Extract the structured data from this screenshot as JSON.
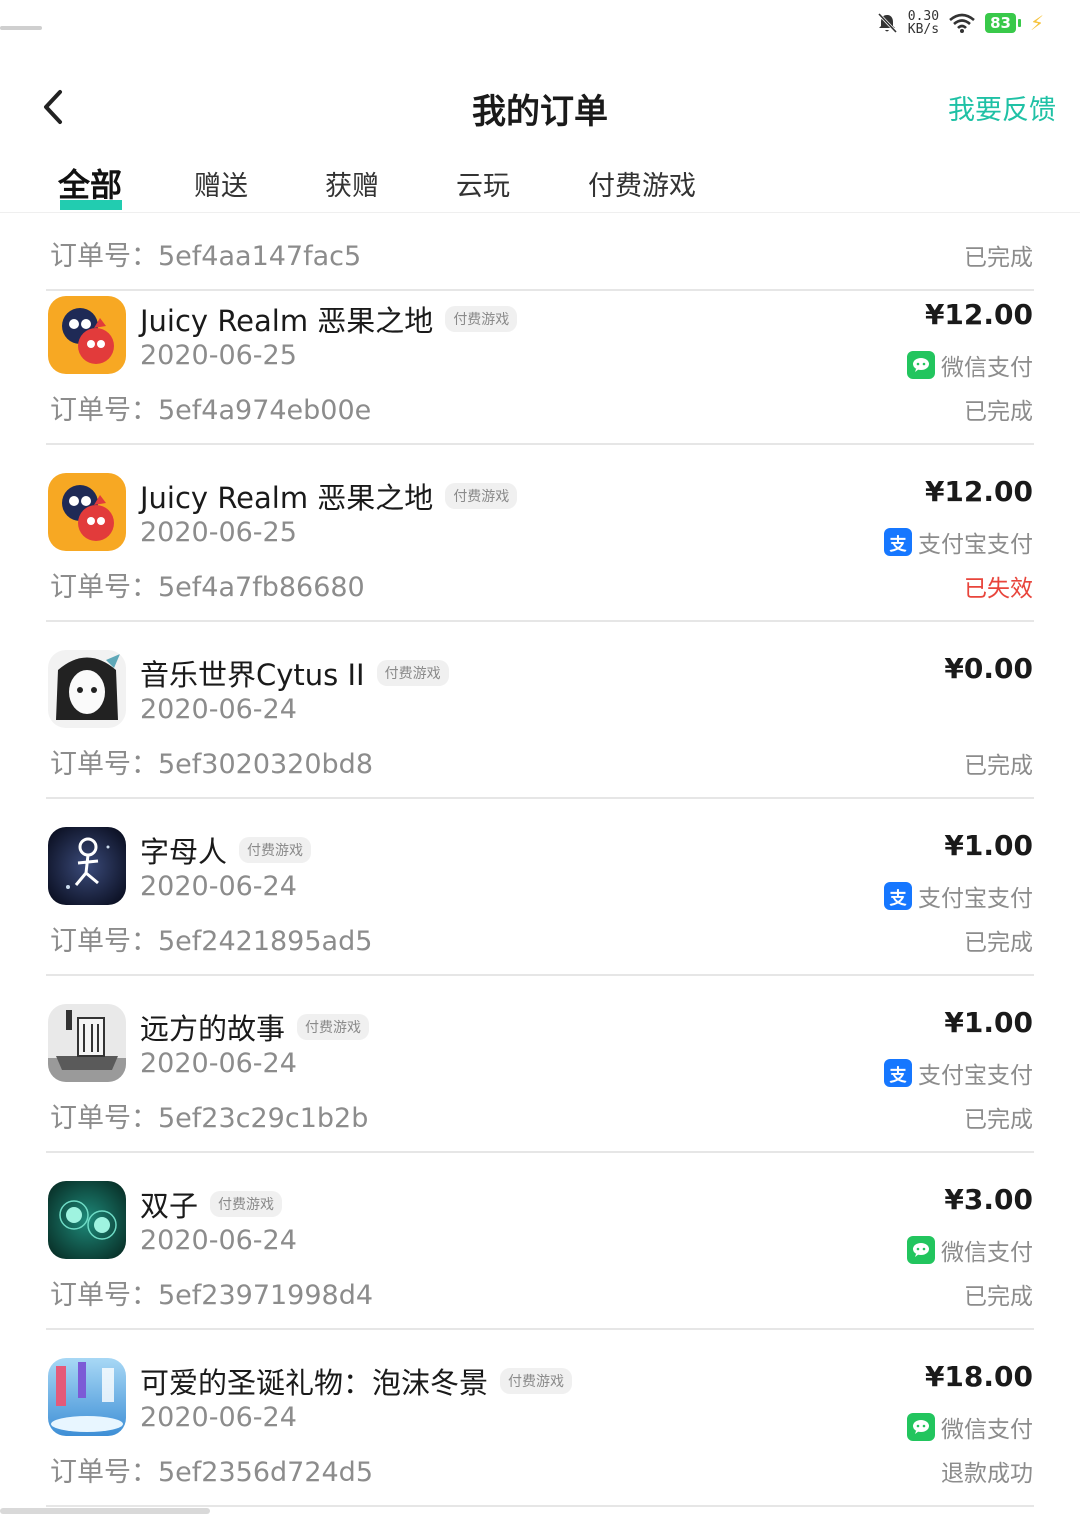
{
  "status_bar": {
    "speed": "0.30",
    "speed_unit": "KB/s",
    "battery": "83"
  },
  "header": {
    "title": "我的订单",
    "feedback": "我要反馈"
  },
  "tabs": [
    {
      "label": "全部",
      "active": true
    },
    {
      "label": "赠送"
    },
    {
      "label": "获赠"
    },
    {
      "label": "云玩"
    },
    {
      "label": "付费游戏"
    }
  ],
  "partial_order": {
    "order_label": "订单号：",
    "order_no": "5ef4aa147fac5",
    "status": "已完成"
  },
  "orders": [
    {
      "name": "Juicy Realm 恶果之地",
      "tag": "付费游戏",
      "date": "2020-06-25",
      "order_label": "订单号：",
      "order_no": "5ef4a974eb00e",
      "price": "¥12.00",
      "pay_method": "微信支付",
      "pay_icon": "wechat-icon",
      "status": "已完成",
      "icon": "juicy-realm-icon"
    },
    {
      "name": "Juicy Realm 恶果之地",
      "tag": "付费游戏",
      "date": "2020-06-25",
      "order_label": "订单号：",
      "order_no": "5ef4a7fb86680",
      "price": "¥12.00",
      "pay_method": "支付宝支付",
      "pay_icon": "alipay-icon",
      "status": "已失效",
      "icon": "juicy-realm-icon"
    },
    {
      "name": "音乐世界Cytus II",
      "tag": "付费游戏",
      "date": "2020-06-24",
      "order_label": "订单号：",
      "order_no": "5ef3020320bd8",
      "price": "¥0.00",
      "pay_method": "",
      "pay_icon": "",
      "status": "已完成",
      "icon": "cytus-icon"
    },
    {
      "name": "字母人",
      "tag": "付费游戏",
      "date": "2020-06-24",
      "order_label": "订单号：",
      "order_no": "5ef2421895ad5",
      "price": "¥1.00",
      "pay_method": "支付宝支付",
      "pay_icon": "alipay-icon",
      "status": "已完成",
      "icon": "alphabet-man-icon"
    },
    {
      "name": "远方的故事",
      "tag": "付费游戏",
      "date": "2020-06-24",
      "order_label": "订单号：",
      "order_no": "5ef23c29c1b2b",
      "price": "¥1.00",
      "pay_method": "支付宝支付",
      "pay_icon": "alipay-icon",
      "status": "已完成",
      "icon": "distant-story-icon"
    },
    {
      "name": "双子",
      "tag": "付费游戏",
      "date": "2020-06-24",
      "order_label": "订单号：",
      "order_no": "5ef23971998d4",
      "price": "¥3.00",
      "pay_method": "微信支付",
      "pay_icon": "wechat-icon",
      "status": "已完成",
      "icon": "gemini-icon"
    },
    {
      "name": "可爱的圣诞礼物：泡沫冬景",
      "tag": "付费游戏",
      "date": "2020-06-24",
      "order_label": "订单号：",
      "order_no": "5ef2356d724d5",
      "price": "¥18.00",
      "pay_method": "微信支付",
      "pay_icon": "wechat-icon",
      "status": "退款成功",
      "icon": "christmas-gift-icon"
    }
  ]
}
